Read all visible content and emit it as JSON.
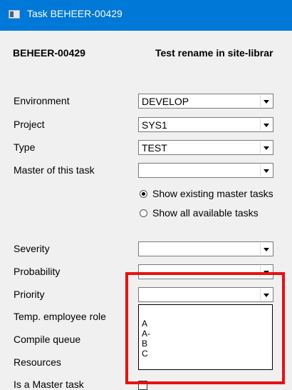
{
  "window": {
    "title": "Task BEHEER-00429",
    "icon": "app-window-icon"
  },
  "header": {
    "code": "BEHEER-00429",
    "description": "Test rename in site-librar"
  },
  "fields": {
    "environment": {
      "label": "Environment",
      "value": "DEVELOP"
    },
    "project": {
      "label": "Project",
      "value": "SYS1"
    },
    "type": {
      "label": "Type",
      "value": "TEST"
    },
    "master": {
      "label": "Master of this task",
      "value": ""
    },
    "severity": {
      "label": "Severity",
      "value": ""
    },
    "probability": {
      "label": "Probability",
      "value": ""
    },
    "priority": {
      "label": "Priority",
      "value": ""
    },
    "temp_role": {
      "label": "Temp. employee role"
    },
    "compile_queue": {
      "label": "Compile queue"
    },
    "resources": {
      "label": "Resources"
    },
    "is_master": {
      "label": "Is a Master task",
      "checked": false
    }
  },
  "radios": [
    {
      "label": "Show existing master tasks",
      "selected": true
    },
    {
      "label": "Show all available tasks",
      "selected": false
    }
  ],
  "priority_options": [
    "A",
    "A-",
    "B",
    "C"
  ],
  "highlight_color": "#e81010"
}
